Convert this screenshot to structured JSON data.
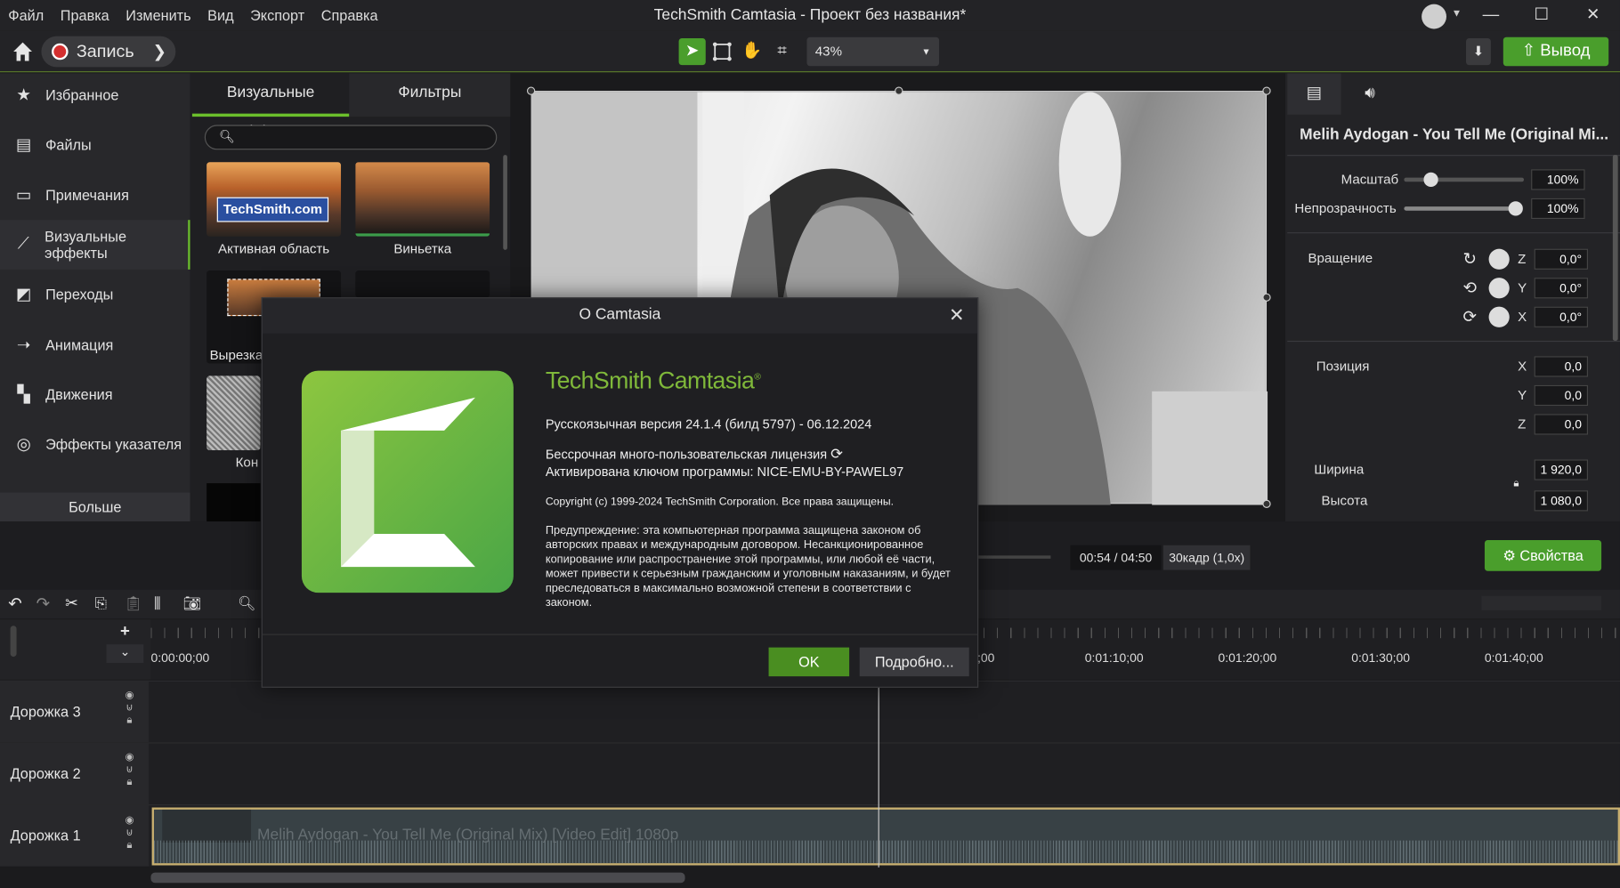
{
  "window": {
    "title": "TechSmith Camtasia - Проект без названия*",
    "min": "—",
    "max": "☐",
    "close": "✕"
  },
  "menu": [
    "Файл",
    "Правка",
    "Изменить",
    "Вид",
    "Экспорт",
    "Справка"
  ],
  "toolbar": {
    "record": "Запись",
    "zoom": "43%",
    "output": "Вывод"
  },
  "sidebar": {
    "items": [
      {
        "label": "Избранное",
        "icon": "star-icon"
      },
      {
        "label": "Файлы",
        "icon": "film-icon"
      },
      {
        "label": "Примечания",
        "icon": "annotation-icon"
      },
      {
        "label": "Визуальные эффекты",
        "icon": "wand-icon"
      },
      {
        "label": "Переходы",
        "icon": "transition-icon"
      },
      {
        "label": "Анимация",
        "icon": "animation-icon"
      },
      {
        "label": "Движения",
        "icon": "behaviors-icon"
      },
      {
        "label": "Эффекты указателя",
        "icon": "cursor-effects-icon"
      }
    ],
    "more": "Больше"
  },
  "effects": {
    "tabs": [
      "Визуальные эффекты",
      "Фильтры"
    ],
    "thumbs": [
      {
        "label": "Активная область",
        "overlay": "TechSmith.com"
      },
      {
        "label": "Виньетка"
      },
      {
        "label": "Вырезка"
      },
      {
        "label": ""
      },
      {
        "label": "Кон"
      }
    ]
  },
  "props": {
    "clip_title": "Melih Aydogan - You Tell Me (Original Mi...",
    "scale_label": "Масштаб",
    "scale": "100%",
    "opacity_label": "Непрозрачность",
    "opacity": "100%",
    "rotation_label": "Вращение",
    "rot_z": "0,0°",
    "rot_y": "0,0°",
    "rot_x": "0,0°",
    "position_label": "Позиция",
    "pos_x": "0,0",
    "pos_y": "0,0",
    "pos_z": "0,0",
    "width_label": "Ширина",
    "width": "1 920,0",
    "height_label": "Высота",
    "height": "1 080,0",
    "axis_x": "X",
    "axis_y": "Y",
    "axis_z": "Z"
  },
  "playback": {
    "time": "00:54 / 04:50",
    "fps": "30кадр (1,0x)",
    "properties": "Свойства"
  },
  "timeline": {
    "ticks": [
      "0:00:00;00",
      ";00",
      "0:01:10;00",
      "0:01:20;00",
      "0:01:30;00",
      "0:01:40;00"
    ],
    "tracks": [
      "Дорожка 3",
      "Дорожка 2",
      "Дорожка 1"
    ],
    "clip": "Melih Aydogan - You Tell Me (Original Mix) [Video Edit]  1080p"
  },
  "dialog": {
    "title": "О Camtasia",
    "product": "TechSmith Camtasia",
    "reg": "®",
    "version": "Русскоязычная версия 24.1.4 (билд 5797) - 06.12.2024",
    "license": "Бессрочная много-пользовательская лицензия",
    "activated": "Активирована ключом программы: NICE-EMU-BY-PAWEL97",
    "copyright": "Copyright (c) 1999-2024 TechSmith Corporation. Все права защищены.",
    "warning": "Предупреждение: эта компьютерная программа защищена законом об авторских правах и международным договором. Несанкционированное копирование или распространение этой программы, или любой её части, может привести к серьезным гражданским и уголовным наказаниям, и будет преследоваться в максимально возможной степени в соответствии с законом.",
    "ok": "OK",
    "details": "Подробно..."
  },
  "colors": {
    "accent": "#4a9e2c",
    "logo_green": "#8dc63f",
    "record_red": "#d42f2f"
  }
}
